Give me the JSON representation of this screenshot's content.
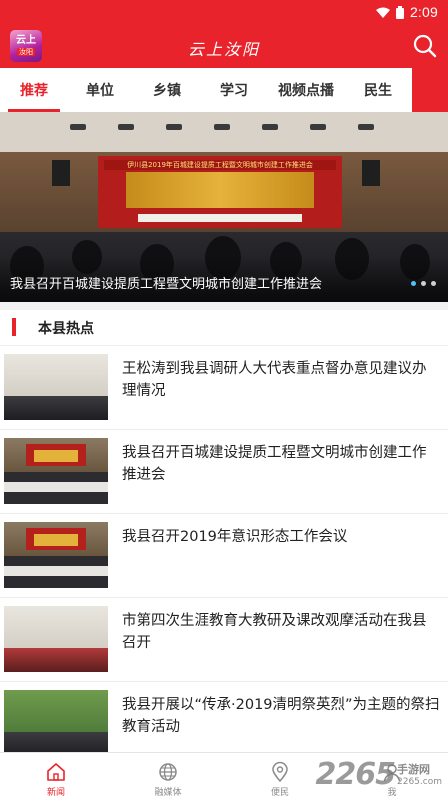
{
  "status_bar": {
    "time": "2:09"
  },
  "header": {
    "title": "云上汝阳",
    "logo_line1": "云上",
    "logo_line2": "汝阳",
    "search_icon": "search-icon"
  },
  "tabs": [
    {
      "label": "推荐",
      "active": true
    },
    {
      "label": "单位"
    },
    {
      "label": "乡镇"
    },
    {
      "label": "学习"
    },
    {
      "label": "视频点播"
    },
    {
      "label": "民生"
    }
  ],
  "banner": {
    "caption": "我县召开百城建设提质工程暨文明城市创建工作推进会",
    "stage_title": "伊川县2019年百城建设提质工程暨文明城市创建工作推进会"
  },
  "section": {
    "title": "本县热点"
  },
  "news": [
    {
      "title": "王松涛到我县调研人大代表重点督办意见建议办理情况"
    },
    {
      "title": "我县召开百城建设提质工程暨文明城市创建工作推进会"
    },
    {
      "title": "我县召开2019年意识形态工作会议"
    },
    {
      "title": "市第四次生涯教育大教研及课改观摩活动在我县召开"
    },
    {
      "title": "我县开展以“传承·2019清明祭英烈”为主题的祭扫教育活动"
    }
  ],
  "bottom_nav": [
    {
      "label": "新闻",
      "icon": "home-icon",
      "active": true
    },
    {
      "label": "融媒体",
      "icon": "globe-icon"
    },
    {
      "label": "便民",
      "icon": "location-pin-icon"
    },
    {
      "label": "我",
      "icon": "user-icon"
    }
  ],
  "watermark": {
    "number": "2265",
    "cn": "手游网",
    "url": "2265.com"
  },
  "colors": {
    "accent": "#e8232b",
    "active_dot": "#4fc3f7"
  }
}
